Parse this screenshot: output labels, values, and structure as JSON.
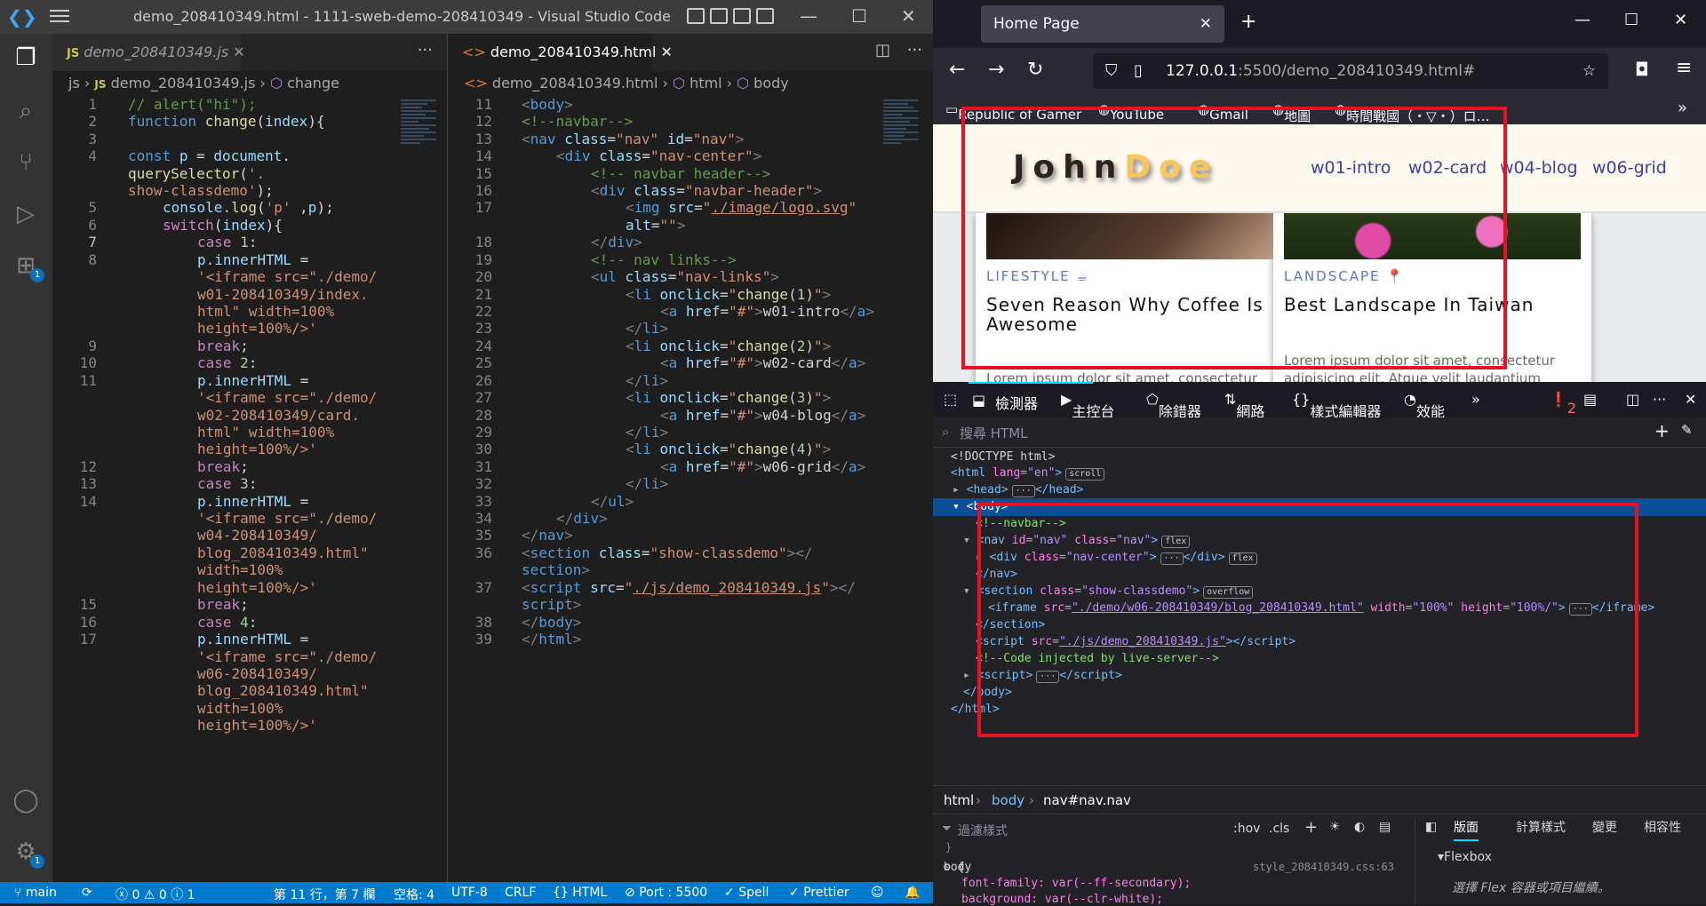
{
  "vscode": {
    "window_title": "demo_208410349.html - 1111-sweb-demo-208410349 - Visual Studio Code",
    "left_tab": "demo_208410349.js",
    "left_breadcrumb": [
      "js",
      "demo_208410349.js",
      "change"
    ],
    "right_tab": "demo_208410349.html",
    "right_breadcrumb": [
      "demo_208410349.html",
      "html",
      "body"
    ],
    "activity_badge_ext": "1",
    "activity_badge_settings": "1",
    "status": {
      "branch": "main",
      "errors": "0",
      "warnings": "0",
      "info": "1",
      "position": "第 11 行，第 7 欄",
      "spaces": "空格: 4",
      "encoding": "UTF-8",
      "eol": "CRLF",
      "lang": "HTML",
      "port": "Port : 5500",
      "spell": "Spell",
      "prettier": "Prettier"
    }
  },
  "firefox": {
    "tab_title": "Home Page",
    "url_host": "127.0.0.1",
    "url_rest": ":5500/demo_208410349.html#",
    "bookmarks": [
      "Republic of Gamer",
      "YouTube",
      "Gmail",
      "地圖",
      "時間戰國（・▽・）ロ…"
    ],
    "site": {
      "logo_a": "John",
      "logo_b": "Doe",
      "links": [
        "w01-intro",
        "w02-card",
        "w04-blog",
        "w06-grid"
      ]
    },
    "cards": [
      {
        "category": "LIFESTYLE",
        "title": "Seven Reason Why Coffee Is Awesome",
        "text": "Lorem ipsum dolor sit amet, consectetur adipisicing elit. Atque velit laudantium minima,"
      },
      {
        "category": "LANDSCAPE",
        "title": "Best Landscape In Taiwan",
        "text": "Lorem ipsum dolor sit amet, consectetur adipisicing elit. Atque velit laudantium minima, explicabo dolor delectus."
      }
    ],
    "devtools": {
      "tabs": [
        "檢測器",
        "主控台",
        "除錯器",
        "網路",
        "樣式編輯器",
        "效能"
      ],
      "error_count": "2",
      "search_placeholder": "搜尋 HTML",
      "breadcrumb": [
        "html",
        "body",
        "nav#nav.nav"
      ],
      "filter_placeholder": "過濾樣式",
      "hov": ":hov",
      "cls": ".cls",
      "right_tabs": [
        "版面",
        "計算樣式",
        "變更",
        "相容性"
      ],
      "flexbox_title": "Flexbox",
      "flexbox_hint": "選擇 Flex 容器或項目繼續。",
      "rule_selector": "body",
      "rule_source": "style_208410349.css:63",
      "rule_props": [
        "font-family: var(--ff-secondary);",
        "background: var(--clr-white);"
      ]
    }
  }
}
